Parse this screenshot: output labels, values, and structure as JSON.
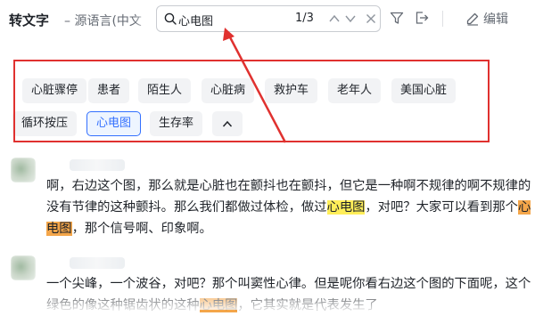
{
  "header": {
    "title": "转文字",
    "subtitle": "– 源语言(中文",
    "search": {
      "value": "心电图",
      "count": "1/3"
    },
    "edit_label": "编辑"
  },
  "keywords": {
    "items": [
      "心脏骤停",
      "患者",
      "陌生人",
      "心脏病",
      "救护车",
      "老年人",
      "美国心脏",
      "循环按压",
      "心电图",
      "生存率"
    ],
    "active": "心电图"
  },
  "transcript": [
    {
      "lines": [
        [
          {
            "t": "啊，右边这个图，那么就是心脏也在颤抖也在颤抖，但它是一种啊不规律的啊不规律的"
          }
        ],
        [
          {
            "t": "没有节律的这种颤抖。那么我们都做过体检，做过"
          },
          {
            "t": "心电图",
            "h": "current"
          },
          {
            "t": "，对吧？大家可以看到那个"
          },
          {
            "t": "心",
            "h": "other"
          }
        ],
        [
          {
            "t": "电图",
            "h": "other"
          },
          {
            "t": "，那个信号啊、印象啊。"
          }
        ]
      ]
    },
    {
      "lines": [
        [
          {
            "t": "一个尖峰，一个波谷，对吧？那个叫窦性心律。但是呢你看右边这个图的下面呢，这个"
          }
        ],
        [
          {
            "t": "绿色的像这种锯齿状的这种"
          },
          {
            "t": "心电图",
            "h": "other"
          },
          {
            "t": "，它其实就是代表发生了"
          }
        ]
      ]
    }
  ],
  "colors": {
    "accent": "#3370ff",
    "highlight_current": "#ffee59",
    "highlight_other": "#f4a64a",
    "annotation": "#e0312f"
  },
  "icons": [
    "search-icon",
    "chevron-up-icon",
    "chevron-down-icon",
    "clear-icon",
    "filter-icon",
    "exit-icon",
    "edit-icon",
    "collapse-icon"
  ]
}
